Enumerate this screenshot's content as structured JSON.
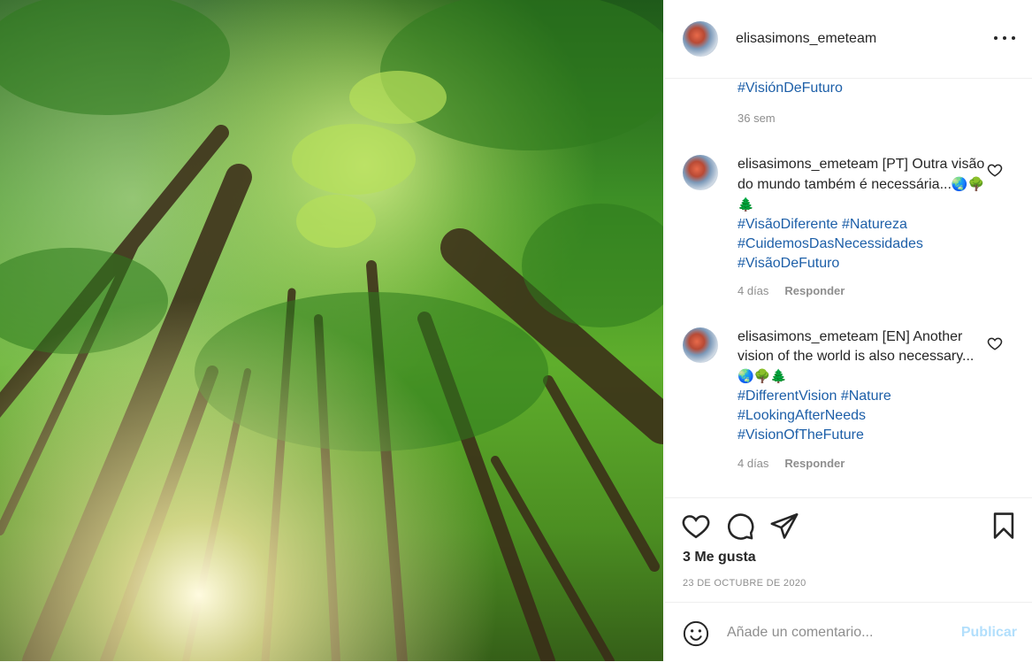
{
  "post": {
    "username": "elisasimons_emeteam",
    "photo_alt": "forest-canopy"
  },
  "caption": {
    "tail_tag": "#VisiónDeFuturo",
    "time": "36 sem"
  },
  "comments": [
    {
      "username": "elisasimons_emeteam",
      "text": "[PT] Outra visão do mundo também é necessária...",
      "emojis": "🌏🌳🌲",
      "tags_line1": [
        "#VisãoDiferente",
        "#Natureza"
      ],
      "tags": [
        "#CuidemosDasNecessidades",
        "#VisãoDeFuturo"
      ],
      "time": "4 días",
      "reply": "Responder"
    },
    {
      "username": "elisasimons_emeteam",
      "text": "[EN] Another vision of the world is also necessary...",
      "emojis": "🌏🌳🌲",
      "tags_line1": [
        "#DifferentVision",
        "#Nature"
      ],
      "tags": [
        "#LookingAfterNeeds",
        "#VisionOfTheFuture"
      ],
      "time": "4 días",
      "reply": "Responder"
    }
  ],
  "actions": {
    "likes": "3 Me gusta",
    "date": "23 DE OCTUBRE DE 2020"
  },
  "composer": {
    "placeholder": "Añade un comentario...",
    "publish_label": "Publicar"
  },
  "colors": {
    "hashtag": "#1d5fa8",
    "publish_disabled": "#b2dffc",
    "secondary_text": "#8e8e8e"
  }
}
